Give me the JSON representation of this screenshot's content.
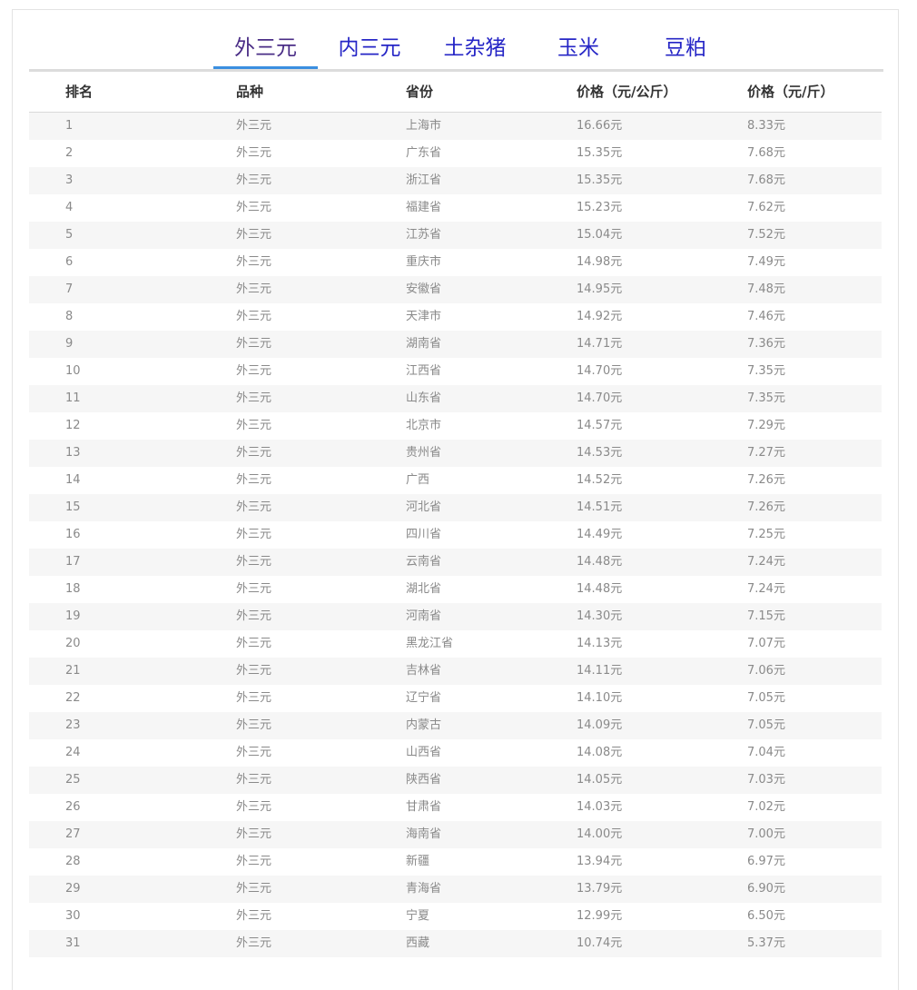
{
  "tabs": [
    "外三元",
    "内三元",
    "土杂猪",
    "玉米",
    "豆粕"
  ],
  "active_tab": 0,
  "table": {
    "headers": [
      "排名",
      "品种",
      "省份",
      "价格（元/公斤）",
      "价格（元/斤）"
    ],
    "rows": [
      [
        "1",
        "外三元",
        "上海市",
        "16.66元",
        "8.33元"
      ],
      [
        "2",
        "外三元",
        "广东省",
        "15.35元",
        "7.68元"
      ],
      [
        "3",
        "外三元",
        "浙江省",
        "15.35元",
        "7.68元"
      ],
      [
        "4",
        "外三元",
        "福建省",
        "15.23元",
        "7.62元"
      ],
      [
        "5",
        "外三元",
        "江苏省",
        "15.04元",
        "7.52元"
      ],
      [
        "6",
        "外三元",
        "重庆市",
        "14.98元",
        "7.49元"
      ],
      [
        "7",
        "外三元",
        "安徽省",
        "14.95元",
        "7.48元"
      ],
      [
        "8",
        "外三元",
        "天津市",
        "14.92元",
        "7.46元"
      ],
      [
        "9",
        "外三元",
        "湖南省",
        "14.71元",
        "7.36元"
      ],
      [
        "10",
        "外三元",
        "江西省",
        "14.70元",
        "7.35元"
      ],
      [
        "11",
        "外三元",
        "山东省",
        "14.70元",
        "7.35元"
      ],
      [
        "12",
        "外三元",
        "北京市",
        "14.57元",
        "7.29元"
      ],
      [
        "13",
        "外三元",
        "贵州省",
        "14.53元",
        "7.27元"
      ],
      [
        "14",
        "外三元",
        "广西",
        "14.52元",
        "7.26元"
      ],
      [
        "15",
        "外三元",
        "河北省",
        "14.51元",
        "7.26元"
      ],
      [
        "16",
        "外三元",
        "四川省",
        "14.49元",
        "7.25元"
      ],
      [
        "17",
        "外三元",
        "云南省",
        "14.48元",
        "7.24元"
      ],
      [
        "18",
        "外三元",
        "湖北省",
        "14.48元",
        "7.24元"
      ],
      [
        "19",
        "外三元",
        "河南省",
        "14.30元",
        "7.15元"
      ],
      [
        "20",
        "外三元",
        "黑龙江省",
        "14.13元",
        "7.07元"
      ],
      [
        "21",
        "外三元",
        "吉林省",
        "14.11元",
        "7.06元"
      ],
      [
        "22",
        "外三元",
        "辽宁省",
        "14.10元",
        "7.05元"
      ],
      [
        "23",
        "外三元",
        "内蒙古",
        "14.09元",
        "7.05元"
      ],
      [
        "24",
        "外三元",
        "山西省",
        "14.08元",
        "7.04元"
      ],
      [
        "25",
        "外三元",
        "陕西省",
        "14.05元",
        "7.03元"
      ],
      [
        "26",
        "外三元",
        "甘肃省",
        "14.03元",
        "7.02元"
      ],
      [
        "27",
        "外三元",
        "海南省",
        "14.00元",
        "7.00元"
      ],
      [
        "28",
        "外三元",
        "新疆",
        "13.94元",
        "6.97元"
      ],
      [
        "29",
        "外三元",
        "青海省",
        "13.79元",
        "6.90元"
      ],
      [
        "30",
        "外三元",
        "宁夏",
        "12.99元",
        "6.50元"
      ],
      [
        "31",
        "外三元",
        "西藏",
        "10.74元",
        "5.37元"
      ]
    ]
  }
}
